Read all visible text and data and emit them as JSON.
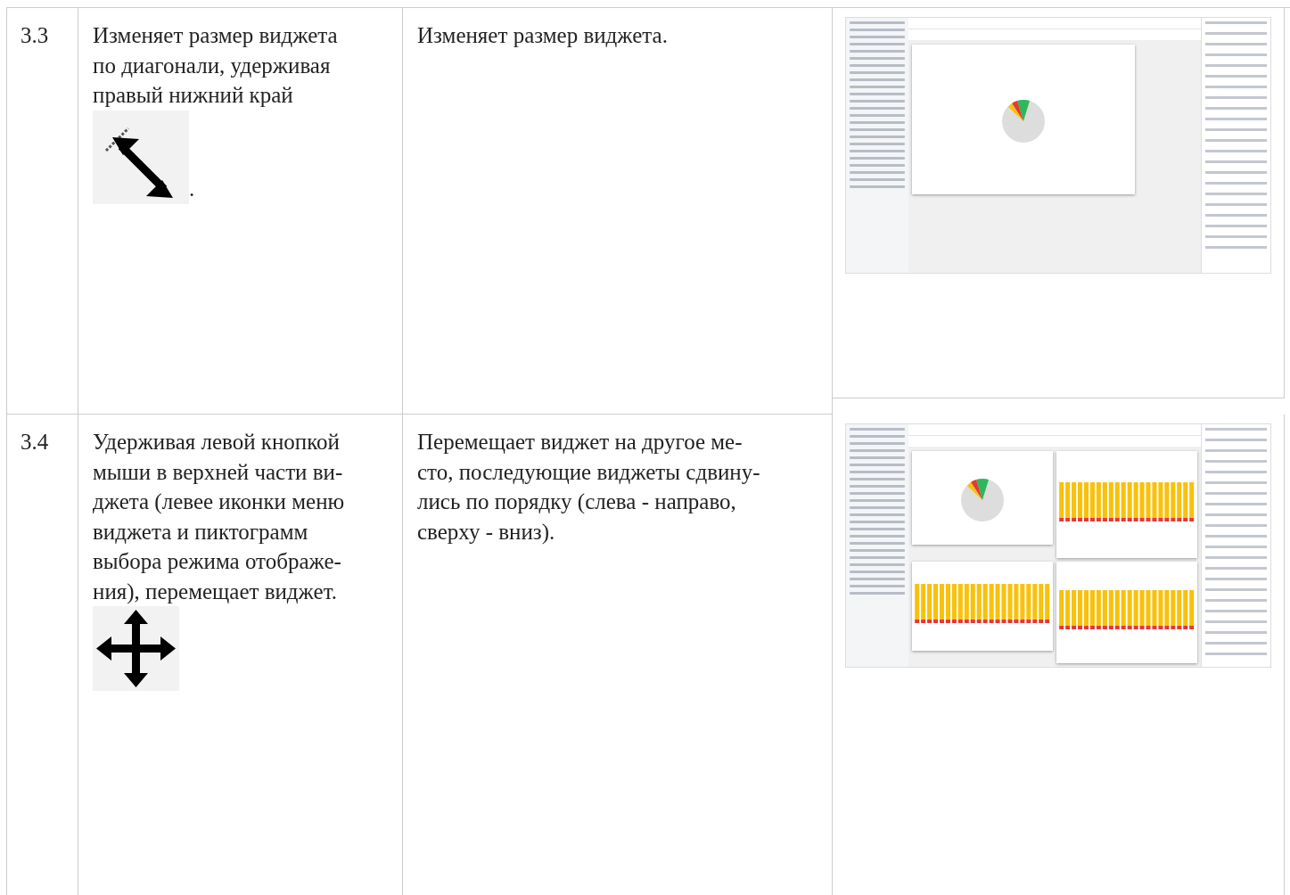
{
  "rows": [
    {
      "number": "3.3",
      "action_lines": [
        "Изменяет размер виджета",
        "по диагонали, удерживая",
        "правый нижний край"
      ],
      "kind": "resize",
      "icon_suffix": ".",
      "result_lines": [
        "Изменяет размер виджета."
      ]
    },
    {
      "number": "3.4",
      "action_lines": [
        "Удерживая левой кнопкой",
        "мыши в верхней части ви-",
        "джета (левее иконки меню",
        "виджета и пиктограмм",
        "выбора режима отображе-",
        "ния), перемещает виджет."
      ],
      "kind": "move",
      "result_lines": [
        "Перемещает виджет на другое ме-",
        "сто, последующие виджеты сдвину-",
        "лись по порядку (слева - направо,",
        "сверху - вниз)."
      ]
    }
  ]
}
